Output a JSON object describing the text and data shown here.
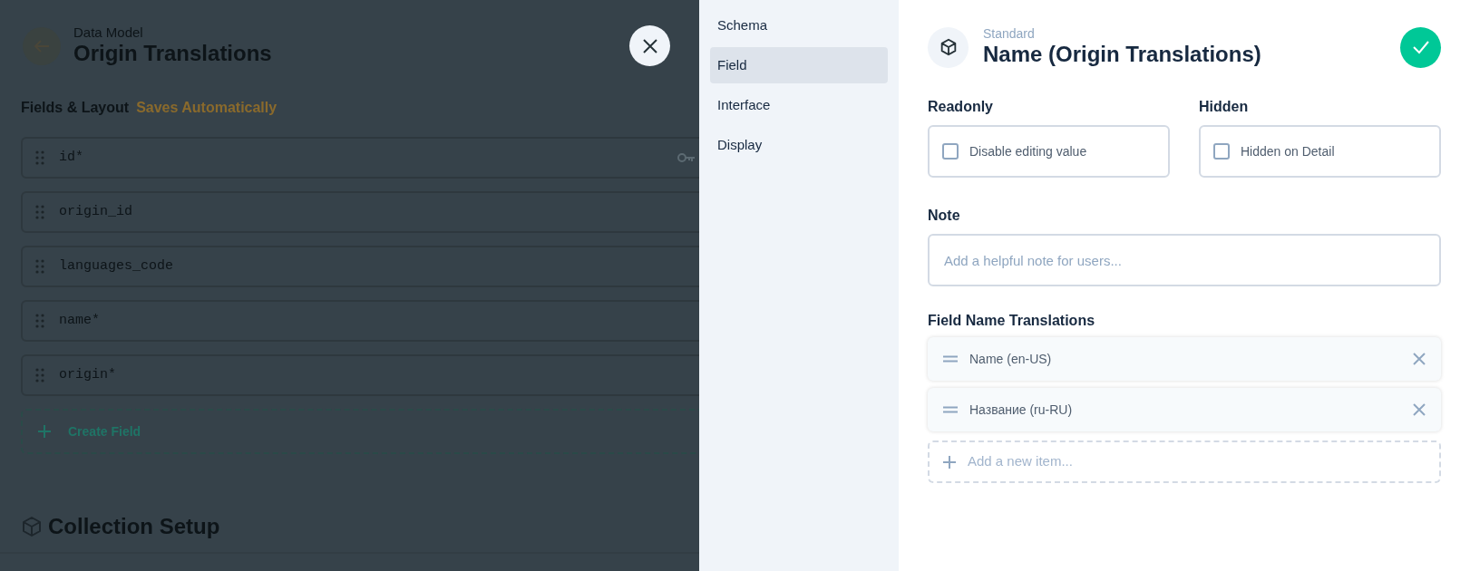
{
  "background_page": {
    "breadcrumb": "Data Model",
    "title": "Origin Translations",
    "section_title": "Fields & Layout",
    "save_note": "Saves Automatically",
    "fields": [
      {
        "name": "id",
        "required_mark": "*",
        "primary_key": true
      },
      {
        "name": "origin_id",
        "primary_key": false
      },
      {
        "name": "languages_code",
        "primary_key": false
      },
      {
        "name": "name",
        "required_mark": "*",
        "primary_key": false
      },
      {
        "name": "origin",
        "required_mark": "*",
        "primary_key": false
      }
    ],
    "create_field": "Create Field",
    "collection_setup": "Collection Setup"
  },
  "drawer": {
    "sidebar": {
      "items": [
        {
          "label": "Schema",
          "selected": false
        },
        {
          "label": "Field",
          "selected": true
        },
        {
          "label": "Interface",
          "selected": false
        },
        {
          "label": "Display",
          "selected": false
        }
      ]
    },
    "header": {
      "subtitle": "Standard",
      "title": "Name (Origin Translations)"
    },
    "readonly": {
      "label": "Readonly",
      "option": "Disable editing value",
      "checked": false
    },
    "hidden": {
      "label": "Hidden",
      "option": "Hidden on Detail",
      "checked": false
    },
    "note": {
      "label": "Note",
      "placeholder": "Add a helpful note for users..."
    },
    "translations": {
      "label": "Field Name Translations",
      "items": [
        {
          "text": "Name (en-US)"
        },
        {
          "text": "Название (ru-RU)"
        }
      ],
      "add_item": "Add a new item..."
    }
  }
}
